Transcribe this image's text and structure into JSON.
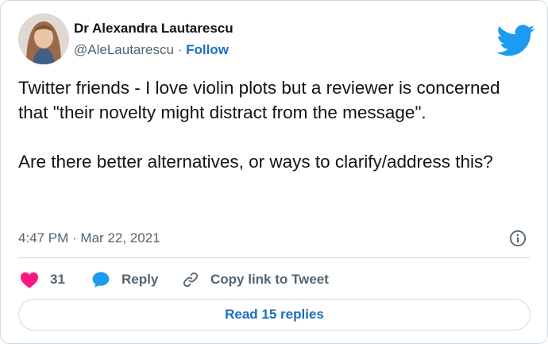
{
  "author": {
    "display_name": "Dr Alexandra Lautarescu",
    "handle": "@AleLautarescu",
    "separator": "·",
    "follow_label": "Follow"
  },
  "tweet": {
    "text": "Twitter friends - I love violin plots but a reviewer is concerned that \"their novelty might distract from the message\".\n\nAre there better alternatives, or ways to clarify/address this?",
    "timestamp": "4:47 PM · Mar 22, 2021"
  },
  "actions": {
    "like_count": "31",
    "reply_label": "Reply",
    "copy_label": "Copy link to Tweet"
  },
  "read_replies_label": "Read 15 replies",
  "colors": {
    "twitter_blue": "#1d9bf0",
    "link_blue": "#1b6ec2",
    "heart_pink": "#f91880",
    "text_primary": "#0f1419",
    "text_secondary": "#536471",
    "border": "#cfd9de"
  },
  "icons": [
    "twitter-bird-icon",
    "info-icon",
    "heart-icon",
    "speech-bubble-icon",
    "link-icon"
  ]
}
